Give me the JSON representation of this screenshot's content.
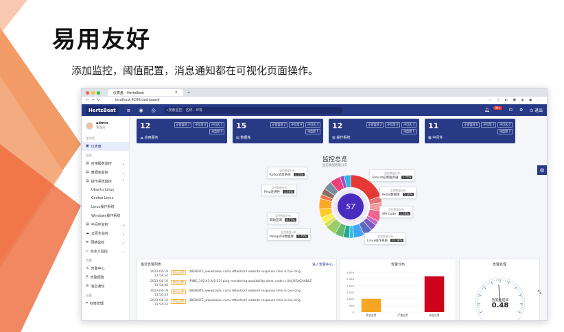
{
  "slide": {
    "title": "易用友好",
    "subtitle": "添加监控，阈值配置，消息通知都在可视化页面操作。"
  },
  "browser": {
    "tab_title": "仪表盘 - HertzBeat",
    "address": "localhost:4200/dashboard"
  },
  "appbar": {
    "logo": "HertzBeat",
    "search_placeholder": "搜索监控：名称、IP等",
    "notify_count": "99+",
    "logout": "退出"
  },
  "user": {
    "name": "admin",
    "role": "管理员"
  },
  "sidebar": {
    "sec_main": "主导航",
    "dashboard": "仪表盘",
    "sec_monitor": "监控",
    "items": [
      "应用服务监控",
      "数据库监控",
      "操作系统监控"
    ],
    "subitems": [
      "Ubuntu Linux",
      "Centos Linux",
      "Linux操作系统",
      "Windows操作系统"
    ],
    "items2": [
      "中间件监控",
      "云原生监控",
      "网络监控",
      "自定义监控"
    ],
    "sec_alert": "告警",
    "alerts": [
      "告警中心",
      "告警阈值",
      "消息通知"
    ],
    "sec_settings": "设置",
    "settings": [
      "标签管理"
    ]
  },
  "cards": [
    {
      "num": "12",
      "name": "应用服务",
      "stats": [
        "正常监控 7",
        "不可用 4",
        "不可达 1",
        "未监控 0"
      ]
    },
    {
      "num": "15",
      "name": "数据库",
      "stats": [
        "正常监控 2",
        "不可用 9",
        "不可达 4",
        "未监控 1"
      ]
    },
    {
      "num": "12",
      "name": "操作系统",
      "stats": [
        "正常监控 2",
        "不可用 6",
        "不可达 3",
        "未监控 1"
      ]
    },
    {
      "num": "11",
      "name": "中间件",
      "stats": [
        "正常监控 6",
        "不可用 3",
        "不可达 0",
        "未监控 2"
      ]
    }
  ],
  "overview": {
    "title": "监控总览",
    "subtitle": "监控类型数量分布",
    "center": "57",
    "tip_head": "监控数量分布",
    "tips": [
      {
        "name": "Kafka消息系统",
        "val": "3.51%"
      },
      {
        "name": "Ping连通性",
        "val": "1.76%"
      },
      {
        "name": "网站监测",
        "val": "8.77%"
      },
      {
        "name": "MongoDB数据库",
        "val": "1.75%"
      },
      {
        "name": "Tomcat应用服务器",
        "val": "1.75%"
      },
      {
        "name": "Redis数据库",
        "val": "5.26%"
      },
      {
        "name": "API Code",
        "val": "1.76%"
      },
      {
        "name": "Linux操作系统",
        "val": "31.58%"
      }
    ]
  },
  "alerts_panel": {
    "title": "最近告警列表",
    "link": "进入告警中心",
    "rows": [
      {
        "time": "2023-04-19 13:54:54",
        "tag": "警告告警",
        "msg": "[WEBSITE_www.baidu.com] Attention! website response time is too long."
      },
      {
        "time": "2023-04-19 13:54:48",
        "tag": "警告告警",
        "msg": "[PING_192.43.4.0.53] ping monitoring availability alert, code is UN_REACHABLE"
      },
      {
        "time": "2023-04-19 13:54:43",
        "tag": "警告告警",
        "msg": "[WEBSITE_www.baidu.com] Attention! website response time is too long."
      },
      {
        "time": "2023-04-19 13:54:43",
        "tag": "警告告警",
        "msg": "[WEBSITE_www.baidu.com] Attention! website response time is too long."
      }
    ]
  },
  "chart_data": {
    "type": "bar",
    "title": "告警分布",
    "categories": [
      "警告告警",
      "严重告警",
      "紧急告警"
    ],
    "values": [
      1000,
      0,
      2700
    ],
    "ylim": [
      0,
      3000
    ],
    "ticks": [
      "3,000",
      "2,500",
      "2,000",
      "1,500",
      "1,000",
      "500",
      "0"
    ],
    "colors": [
      "#f5a623",
      "#999999",
      "#d0021b"
    ]
  },
  "gauge": {
    "title": "告警处理",
    "label": "告警处理率",
    "value": "0.48",
    "value_fraction": 0.48
  }
}
